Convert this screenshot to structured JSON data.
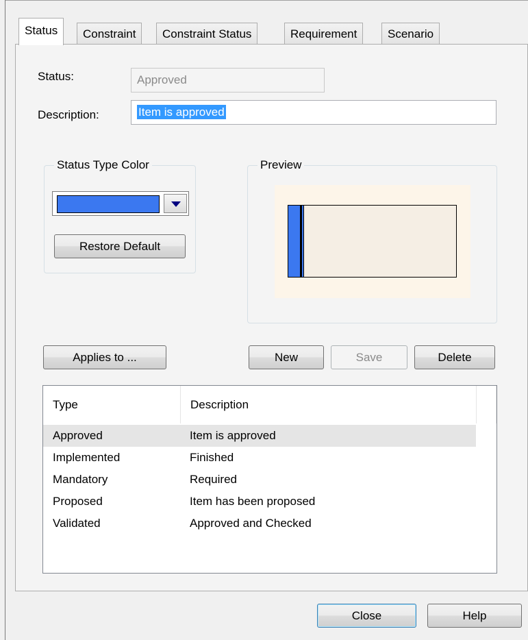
{
  "tabs": [
    "Status",
    "Constraint",
    "Constraint Status",
    "Requirement",
    "Scenario"
  ],
  "active_tab": "Status",
  "form": {
    "status_label": "Status:",
    "status_value": "Approved",
    "description_label": "Description:",
    "description_value": "Item is approved"
  },
  "status_type_color": {
    "legend": "Status Type Color",
    "color": "#3b78f0",
    "restore_label": "Restore Default"
  },
  "preview": {
    "legend": "Preview",
    "bar_color": "#3b78f0"
  },
  "buttons": {
    "applies_to": "Applies to ...",
    "new": "New",
    "save": "Save",
    "delete": "Delete",
    "close": "Close",
    "help": "Help"
  },
  "list": {
    "columns": [
      "Type",
      "Description"
    ],
    "rows": [
      {
        "type": "Approved",
        "description": "Item is approved"
      },
      {
        "type": "Implemented",
        "description": "Finished"
      },
      {
        "type": "Mandatory",
        "description": "Required"
      },
      {
        "type": "Proposed",
        "description": "Item has been proposed"
      },
      {
        "type": "Validated",
        "description": "Approved and Checked"
      }
    ],
    "selected_index": 0
  }
}
